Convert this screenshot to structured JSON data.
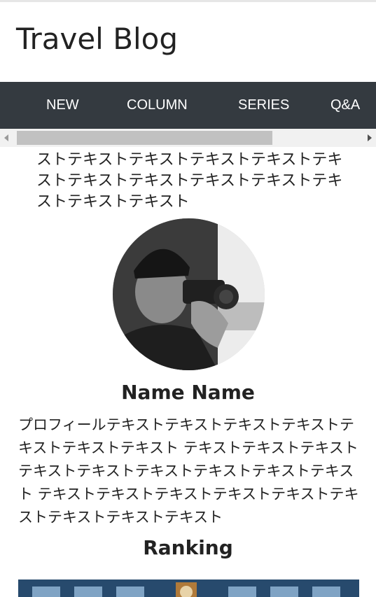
{
  "header": {
    "site_title": "Travel Blog"
  },
  "nav": {
    "items": [
      {
        "label": "NEW"
      },
      {
        "label": "COLUMN"
      },
      {
        "label": "SERIES"
      },
      {
        "label": "Q&A"
      }
    ]
  },
  "article": {
    "cut_text": "ストテキストテキストテキストテキストテキストテキストテキストテキストテキストテキストテキストテキスト"
  },
  "profile": {
    "name": "Name Name",
    "text": "プロフィールテキストテキストテキストテキストテキストテキストテキスト テキストテキストテキストテキストテキストテキストテキストテキストテキスト テキストテキストテキストテキストテキストテキストテキストテキストテキスト"
  },
  "ranking": {
    "title": "Ranking"
  },
  "colors": {
    "nav_bg": "#343a40",
    "nav_text": "#ffffff",
    "text": "#222222"
  }
}
